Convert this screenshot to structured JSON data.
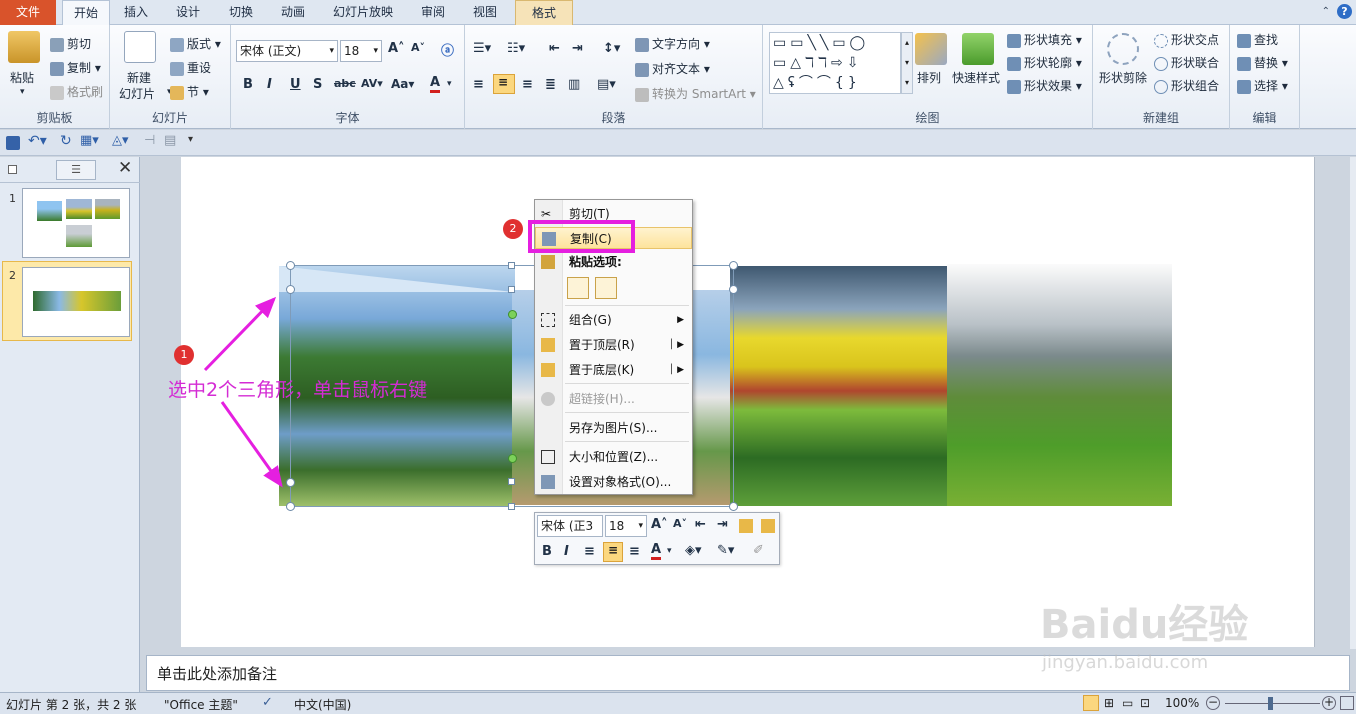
{
  "tabs": [
    "文件",
    "开始",
    "插入",
    "设计",
    "切换",
    "动画",
    "幻灯片放映",
    "审阅",
    "视图",
    "格式"
  ],
  "clipboard": {
    "paste": "粘贴",
    "cut": "剪切",
    "copy": "复制",
    "format_painter": "格式刷",
    "label": "剪贴板"
  },
  "slides_group": {
    "new_slide_1": "新建",
    "new_slide_2": "幻灯片",
    "layout": "版式",
    "reset": "重设",
    "section": "节",
    "label": "幻灯片"
  },
  "font": {
    "name": "宋体 (正文)",
    "size": "18",
    "label": "字体"
  },
  "paragraph": {
    "text_direction": "文字方向",
    "align_text": "对齐文本",
    "smartart": "转换为 SmartArt",
    "label": "段落"
  },
  "drawing": {
    "arrange": "排列",
    "quick_styles": "快速样式",
    "shape_fill": "形状填充",
    "shape_outline": "形状轮廓",
    "shape_effects": "形状效果",
    "label": "绘图"
  },
  "new_group": {
    "shape_cut": "形状剪除",
    "shape_intersect": "形状交点",
    "shape_union": "形状联合",
    "shape_combine": "形状组合",
    "label": "新建组"
  },
  "editing": {
    "find": "查找",
    "replace": "替换",
    "select": "选择",
    "label": "编辑"
  },
  "slide_numbers": [
    "1",
    "2"
  ],
  "annotation": {
    "badge1": "1",
    "badge2": "2",
    "text": "选中2个三角形，单击鼠标右键"
  },
  "context_menu": {
    "cut": "剪切(T)",
    "copy": "复制(C)",
    "paste_options": "粘贴选项:",
    "group": "组合(G)",
    "bring_front": "置于顶层(R)",
    "send_back": "置于底层(K)",
    "hyperlink": "超链接(H)...",
    "save_picture": "另存为图片(S)...",
    "size_position": "大小和位置(Z)...",
    "format_object": "设置对象格式(O)..."
  },
  "mini_toolbar": {
    "font": "宋体 (正3",
    "size": "18"
  },
  "notes_placeholder": "单击此处添加备注",
  "status": {
    "slide_info": "幻灯片 第 2 张，共 2 张",
    "theme": "\"Office 主题\"",
    "language": "中文(中国)",
    "zoom": "100%"
  },
  "watermark": {
    "brand": "Baidu经验",
    "url": "jingyan.baidu.com"
  },
  "colors": {
    "file_tab": "#d9532b",
    "highlight": "#e51fe0",
    "annotation": "#d42bd4",
    "badge": "#e03030",
    "menu_hover": "#fde7a7"
  }
}
